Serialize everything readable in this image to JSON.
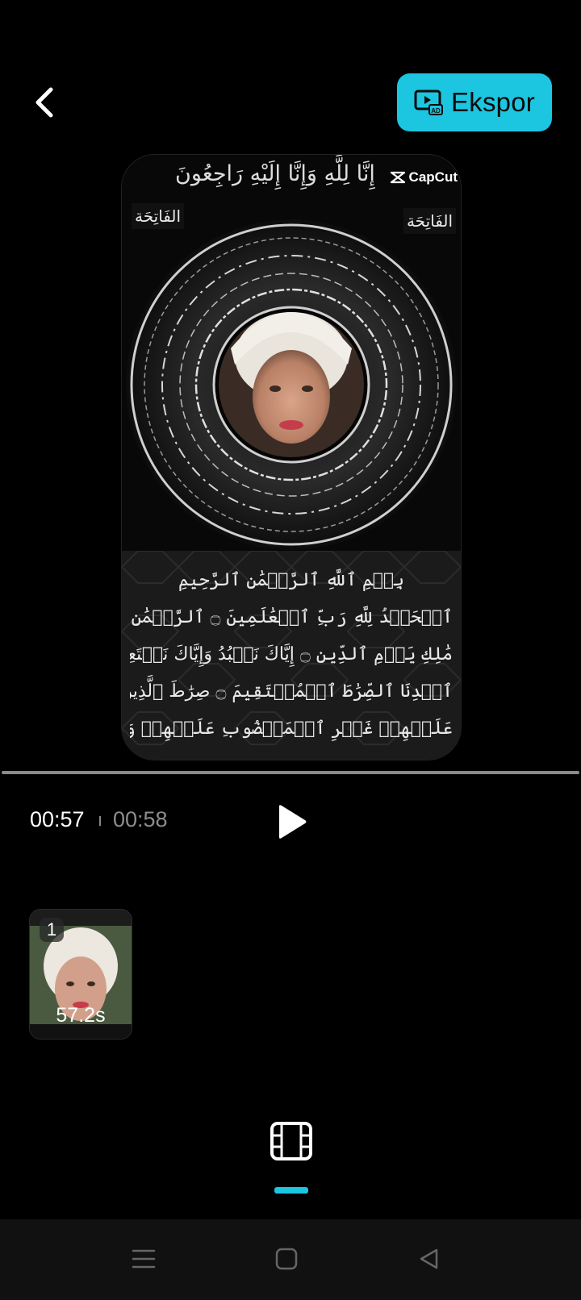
{
  "header": {
    "back_icon": "chevron-left-icon",
    "export_label": "Ekspor",
    "export_icon": "ad-screen-icon",
    "accent_color": "#1cc5e0"
  },
  "preview": {
    "watermark": "CapCut",
    "top_arabic": "إِنَّا لِلَّهِ وَإِنَّا إِلَيْهِ رَاجِعُونَ",
    "corner_label_left": "الفَاتِحَة",
    "corner_label_right": "الفَاتِحَة",
    "verse_lines": [
      "بِسۡمِ ٱللَّهِ ٱلرَّحۡمَٰنِ ٱلرَّحِيمِ",
      "ٱلۡحَمۡدُ لِلَّهِ رَبِّ ٱلۡعَٰلَمِينَ ۝ ٱلرَّحۡمَٰنِ ٱلرَّحِيمِ ۝",
      "مَٰلِكِ يَوۡمِ ٱلدِّينِ ۝ إِيَّاكَ نَعۡبُدُ وَإِيَّاكَ نَسۡتَعِينُ ۝",
      "ٱهۡدِنَا ٱلصِّرَٰطَ ٱلۡمُسۡتَقِيمَ ۝ صِرَٰطَ ٱلَّذِينَ أَنۡعَمۡتَ",
      "عَلَيۡهِمۡ غَيۡرِ ٱلۡمَغۡضُوبِ عَلَيۡهِمۡ وَلَا ٱلضَّآلِّينَ ۝"
    ]
  },
  "playback": {
    "current_time": "00:57",
    "total_time": "00:58",
    "play_icon": "play-icon"
  },
  "clips": [
    {
      "index": "1",
      "duration": "57.2s"
    }
  ],
  "toolbar": {
    "active_tool_icon": "film-icon"
  },
  "system_nav": {
    "menu_icon": "menu-icon",
    "home_icon": "home-square-icon",
    "back_icon": "back-triangle-icon"
  }
}
